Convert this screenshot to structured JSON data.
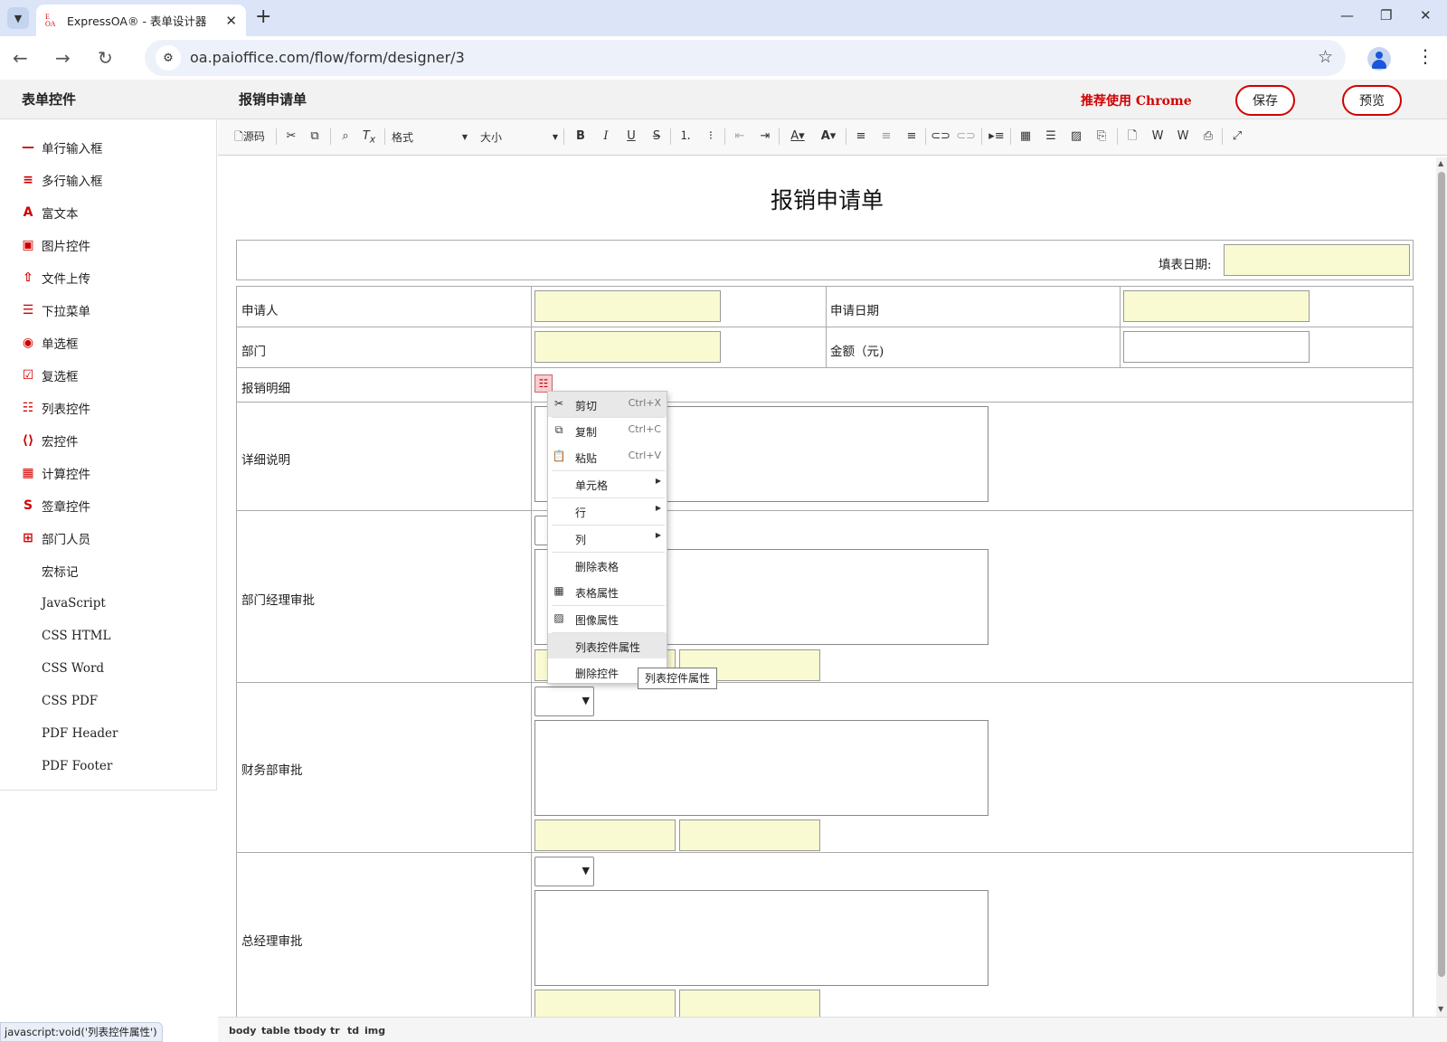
{
  "browser": {
    "tab_title": "ExpressOA® - 表单设计器",
    "url": "oa.paioffice.com/flow/form/designer/3",
    "hover_status": "javascript:void('列表控件属性')"
  },
  "header": {
    "left_title": "表单控件",
    "form_title": "报销申请单",
    "recommend": "推荐使用 Chrome",
    "save_label": "保存",
    "preview_label": "预览"
  },
  "sidebar": {
    "items": [
      {
        "icon": "single-line-icon",
        "glyph": "—",
        "label": "单行输入框"
      },
      {
        "icon": "multi-line-icon",
        "glyph": "≡",
        "label": "多行输入框"
      },
      {
        "icon": "rich-text-icon",
        "glyph": "A",
        "label": "富文本"
      },
      {
        "icon": "image-icon",
        "glyph": "▣",
        "label": "图片控件"
      },
      {
        "icon": "file-upload-icon",
        "glyph": "⇧",
        "label": "文件上传"
      },
      {
        "icon": "dropdown-icon",
        "glyph": "☰",
        "label": "下拉菜单"
      },
      {
        "icon": "radio-icon",
        "glyph": "◉",
        "label": "单选框"
      },
      {
        "icon": "checkbox-icon",
        "glyph": "☑",
        "label": "复选框"
      },
      {
        "icon": "list-icon",
        "glyph": "☷",
        "label": "列表控件"
      },
      {
        "icon": "macro-icon",
        "glyph": "⟨⟩",
        "label": "宏控件"
      },
      {
        "icon": "calculator-icon",
        "glyph": "▦",
        "label": "计算控件"
      },
      {
        "icon": "signature-icon",
        "glyph": "S",
        "label": "签章控件"
      },
      {
        "icon": "department-icon",
        "glyph": "⊞",
        "label": "部门人员"
      },
      {
        "icon": "",
        "glyph": "",
        "label": "宏标记"
      },
      {
        "icon": "",
        "glyph": "",
        "label": "JavaScript"
      },
      {
        "icon": "",
        "glyph": "",
        "label": "CSS HTML"
      },
      {
        "icon": "",
        "glyph": "",
        "label": "CSS Word"
      },
      {
        "icon": "",
        "glyph": "",
        "label": "CSS PDF"
      },
      {
        "icon": "",
        "glyph": "",
        "label": "PDF Header"
      },
      {
        "icon": "",
        "glyph": "",
        "label": "PDF Footer"
      }
    ]
  },
  "toolbar": {
    "source_label": "源码",
    "format_label": "格式",
    "size_label": "大小"
  },
  "document": {
    "title": "报销申请单",
    "fill_date_label": "填表日期:",
    "rows": {
      "applicant": "申请人",
      "apply_date": "申请日期",
      "department": "部门",
      "amount": "金额（元)",
      "details": "报销明细",
      "description": "详细说明",
      "dept_manager": "部门经理审批",
      "finance": "财务部审批",
      "gm": "总经理审批"
    }
  },
  "context_menu": {
    "items": [
      {
        "icon": "scissors-icon",
        "label": "剪切",
        "shortcut": "Ctrl+X"
      },
      {
        "icon": "copy-icon",
        "label": "复制",
        "shortcut": "Ctrl+C"
      },
      {
        "icon": "paste-icon",
        "label": "粘贴",
        "shortcut": "Ctrl+V"
      },
      {
        "label": "单元格"
      },
      {
        "label": "行"
      },
      {
        "label": "列"
      },
      {
        "label": "删除表格"
      },
      {
        "icon": "table-icon",
        "label": "表格属性"
      },
      {
        "icon": "image-icon",
        "label": "图像属性"
      },
      {
        "label": "列表控件属性"
      },
      {
        "label": "删除控件"
      }
    ],
    "tooltip": "列表控件属性"
  },
  "statusbar": {
    "path": [
      "body",
      "table",
      "tbody",
      "tr",
      "td",
      "img"
    ]
  },
  "colors": {
    "accent": "#d00000",
    "field_fill": "#fafad2",
    "tabbar": "#dbe5f7"
  }
}
